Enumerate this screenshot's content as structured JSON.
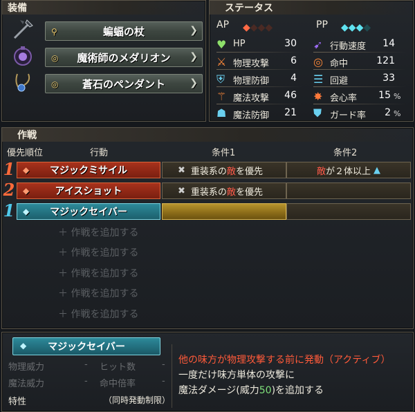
{
  "equipment": {
    "title": "装備",
    "items": [
      {
        "label": "蝙蝠の杖",
        "icon": "staff-icon",
        "slot_icon": "key-icon"
      },
      {
        "label": "魔術師のメダリオン",
        "icon": "medallion-icon",
        "slot_icon": "ring-icon"
      },
      {
        "label": "蒼石のペンダント",
        "icon": "pendant-icon",
        "slot_icon": "ring-icon"
      }
    ]
  },
  "status": {
    "title": "ステータス",
    "ap_label": "AP",
    "pp_label": "PP",
    "ap_filled": 1,
    "ap_total": 4,
    "pp_filled": 3,
    "pp_total": 4,
    "left": [
      {
        "label": "HP",
        "value": "30",
        "icon": "heart-icon"
      },
      {
        "label": "物理攻撃",
        "value": "6",
        "icon": "sword-icon"
      },
      {
        "label": "物理防御",
        "value": "4",
        "icon": "armor-icon"
      },
      {
        "label": "魔法攻撃",
        "value": "46",
        "icon": "wand-icon"
      },
      {
        "label": "魔法防御",
        "value": "21",
        "icon": "magic-shield-icon"
      }
    ],
    "right": [
      {
        "label": "行動速度",
        "value": "14",
        "icon": "speed-icon",
        "unit": ""
      },
      {
        "label": "命中",
        "value": "121",
        "icon": "target-icon",
        "unit": ""
      },
      {
        "label": "回避",
        "value": "33",
        "icon": "evade-icon",
        "unit": ""
      },
      {
        "label": "会心率",
        "value": "15",
        "icon": "critical-icon",
        "unit": "%"
      },
      {
        "label": "ガード率",
        "value": "2",
        "icon": "guard-icon",
        "unit": "%"
      }
    ]
  },
  "tactics": {
    "title": "作戦",
    "headers": {
      "priority": "優先順位",
      "action": "行動",
      "cond1": "条件1",
      "cond2": "条件2"
    },
    "rows": [
      {
        "rank": "1",
        "action": "マジックミサイル",
        "type": "ap",
        "cond1_pre": "重装系の",
        "cond1_enemy": "敵",
        "cond1_post": "を優先",
        "cond2_enemy": "敵",
        "cond2_post": "が２体以上"
      },
      {
        "rank": "2",
        "action": "アイスショット",
        "type": "ap",
        "cond1_pre": "重装系の",
        "cond1_enemy": "敵",
        "cond1_post": "を優先",
        "cond2_enemy": "",
        "cond2_post": ""
      },
      {
        "rank": "1",
        "action": "マジックセイバー",
        "type": "pp",
        "cond1_pre": "",
        "cond1_enemy": "",
        "cond1_post": "",
        "cond2_enemy": "",
        "cond2_post": ""
      }
    ],
    "add_label": "＋ 作戦を追加する"
  },
  "skill": {
    "name": "マジックセイバー",
    "phys_power": "物理威力",
    "hit_count": "ヒット数",
    "mag_power": "魔法威力",
    "hit_mult": "命中倍率",
    "dash": "-",
    "trait_label": "特性",
    "trait_value": "（同時発動制限）",
    "desc_line1": "他の味方が物理攻撃する前に発動（アクティブ）",
    "desc_line2": "一度だけ味方単体の攻撃に",
    "desc_line3_pre": "魔法ダメージ(威力",
    "desc_line3_num": "50",
    "desc_line3_post": ")を追加する"
  },
  "colors": {
    "red_action": "#a8321c",
    "teal_action": "#2d8a9a",
    "enemy": "#ff5a4a",
    "desc_red": "#ff5a3a",
    "green_num": "#7fe07a"
  }
}
